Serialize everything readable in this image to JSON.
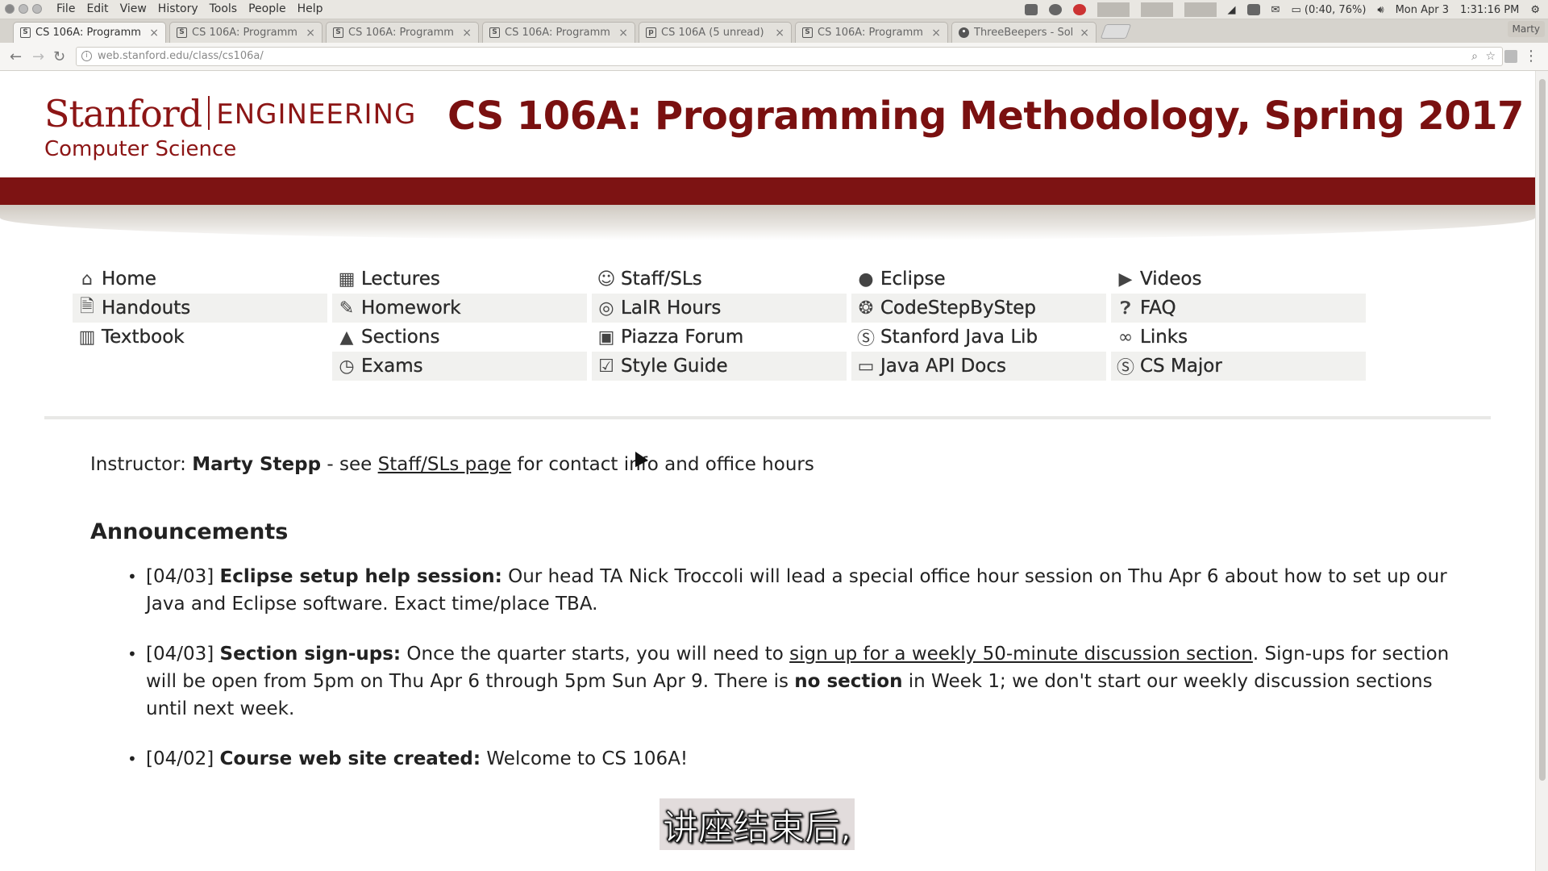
{
  "os": {
    "menus": [
      "File",
      "Edit",
      "View",
      "History",
      "Tools",
      "People",
      "Help"
    ],
    "battery": "(0:40, 76%)",
    "date": "Mon Apr 3",
    "time": "1:31:16 PM"
  },
  "tabs": [
    {
      "title": "CS 106A: Programm",
      "icon": "stanford-s-icon",
      "active": true
    },
    {
      "title": "CS 106A: Programm",
      "icon": "stanford-s-icon"
    },
    {
      "title": "CS 106A: Programm",
      "icon": "stanford-s-icon"
    },
    {
      "title": "CS 106A: Programm",
      "icon": "stanford-s-icon"
    },
    {
      "title": "CS 106A (5 unread)",
      "icon": "piazza-icon"
    },
    {
      "title": "CS 106A: Programm",
      "icon": "stanford-s-icon"
    },
    {
      "title": "ThreeBeepers - Sol",
      "icon": "codestepbystep-icon"
    }
  ],
  "profile_label": "Marty",
  "browser": {
    "url": "web.stanford.edu/class/cs106a/"
  },
  "header": {
    "logo_stanford": "Stanford",
    "logo_engineering": "ENGINEERING",
    "logo_cs": "Computer Science",
    "course_title": "CS 106A: Programming Methodology, Spring 2017"
  },
  "nav": {
    "columns": [
      [
        {
          "label": "Home",
          "icon": "home-icon"
        },
        {
          "label": "Handouts",
          "icon": "document-icon"
        },
        {
          "label": "Textbook",
          "icon": "book-icon"
        }
      ],
      [
        {
          "label": "Lectures",
          "icon": "calendar-icon"
        },
        {
          "label": "Homework",
          "icon": "edit-icon"
        },
        {
          "label": "Sections",
          "icon": "tree-icon"
        },
        {
          "label": "Exams",
          "icon": "clock-icon"
        }
      ],
      [
        {
          "label": "Staff/SLs",
          "icon": "smiley-icon"
        },
        {
          "label": "LaIR Hours",
          "icon": "lifebuoy-icon"
        },
        {
          "label": "Piazza Forum",
          "icon": "piazza-icon"
        },
        {
          "label": "Style Guide",
          "icon": "checkbox-icon"
        }
      ],
      [
        {
          "label": "Eclipse",
          "icon": "eclipse-icon"
        },
        {
          "label": "CodeStepByStep",
          "icon": "codestepbystep-icon"
        },
        {
          "label": "Stanford Java Lib",
          "icon": "stanford-s-icon"
        },
        {
          "label": "Java API Docs",
          "icon": "oracle-icon"
        }
      ],
      [
        {
          "label": "Videos",
          "icon": "play-icon"
        },
        {
          "label": "FAQ",
          "icon": "question-icon"
        },
        {
          "label": "Links",
          "icon": "link-icon"
        },
        {
          "label": "CS Major",
          "icon": "stanford-s-icon"
        }
      ]
    ]
  },
  "instructor": {
    "prefix": "Instructor: ",
    "name": "Marty Stepp",
    "mid": " - see ",
    "link": "Staff/SLs page",
    "suffix": " for contact info and office hours"
  },
  "announcements": {
    "heading": "Announcements",
    "items": [
      {
        "date": "[04/03]",
        "title": "Eclipse setup help session:",
        "body": "Our head TA Nick Troccoli will lead a special office hour session on Thu Apr 6 about how to set up our Java and Eclipse software. Exact time/place TBA."
      },
      {
        "date": "[04/03]",
        "title": "Section sign-ups:",
        "body_pre": "Once the quarter starts, you will need to ",
        "link": "sign up for a weekly 50-minute discussion section",
        "body_mid": ". Sign-ups for section will be open from 5pm on Thu Apr 6 through 5pm Sun Apr 9. There is ",
        "bold": "no section",
        "body_post": " in Week 1; we don't start our weekly discussion sections until next week."
      },
      {
        "date": "[04/02]",
        "title": "Course web site created:",
        "body": "Welcome to CS 106A!"
      }
    ]
  },
  "subtitle": "讲座结束后,",
  "colors": {
    "cardinal": "#8c1515",
    "banner": "#7d1313"
  }
}
